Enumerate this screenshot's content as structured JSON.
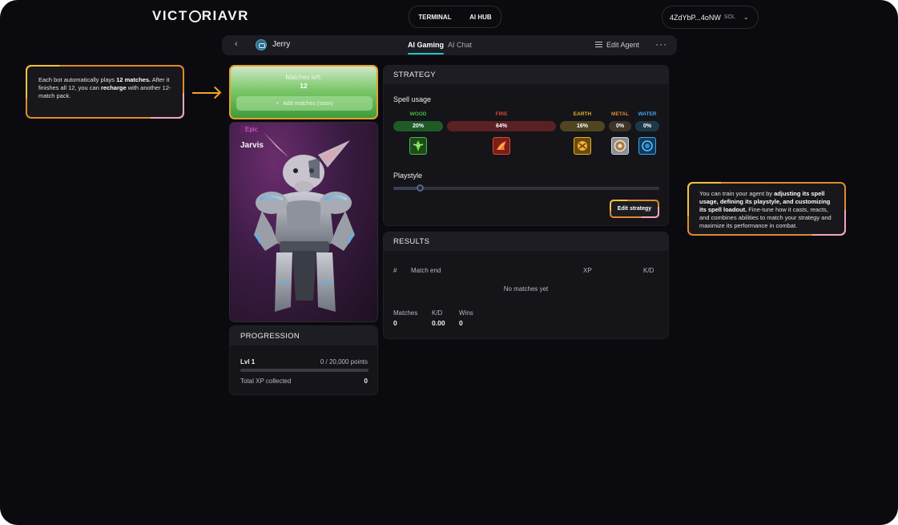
{
  "header": {
    "logo_text_1": "VICT",
    "logo_text_2": "RIAVR",
    "nav": [
      "TERMINAL",
      "AI HUB"
    ],
    "wallet_address": "4ZdYbP...4oNW",
    "wallet_currency": "SOL"
  },
  "agent_bar": {
    "agent_name": "Jerry",
    "tabs": [
      "AI Gaming",
      "AI Chat"
    ],
    "active_tab": "AI Gaming",
    "edit_label": "Edit Agent"
  },
  "callouts": {
    "left": {
      "t1": "Each bot automatically plays ",
      "b1": "12 matches.",
      "t2": " After it finishes all 12, you can ",
      "b2": "recharge",
      "t3": " with another 12-match pack."
    },
    "right": {
      "t1": "You can train your agent by ",
      "b1": "adjusting its spell usage, defining its playstyle, and customizing its spell loadout.",
      "t2": " Fine-tune how it casts, reacts, and combines abilities to match your strategy and maximize its performance in combat."
    }
  },
  "matches": {
    "label": "Matches left:",
    "count": "12",
    "add_button": "Add matches (soon)"
  },
  "character": {
    "rarity": "Epic",
    "name": "Jarvis"
  },
  "progression": {
    "title": "PROGRESSION",
    "level": "Lvl 1",
    "points": "0 / 20,000 points",
    "progress_fraction": 0,
    "xp_label": "Total XP collected",
    "xp_value": "0"
  },
  "strategy": {
    "title": "STRATEGY",
    "spell_usage_label": "Spell usage",
    "elements": [
      {
        "name": "WOOD",
        "percent": "20%",
        "color": "#3fbf3f",
        "pill": "#1f5a27",
        "icon": "wood-spell-icon"
      },
      {
        "name": "FIRE",
        "percent": "64%",
        "color": "#e0453a",
        "pill": "#5a2023",
        "icon": "fire-spell-icon"
      },
      {
        "name": "EARTH",
        "percent": "16%",
        "color": "#e6b320",
        "pill": "#4f4520",
        "icon": "earth-spell-icon"
      },
      {
        "name": "METAL",
        "percent": "0%",
        "color": "#e08a2f",
        "pill": "#3f3428",
        "icon": "metal-spell-icon"
      },
      {
        "name": "WATER",
        "percent": "0%",
        "color": "#3aa7e6",
        "pill": "#1e3a4a",
        "icon": "water-spell-icon"
      }
    ],
    "playstyle_label": "Playstyle",
    "playstyle_value": 0.1,
    "edit_button": "Edit strategy"
  },
  "results": {
    "title": "RESULTS",
    "columns": [
      "#",
      "Match end",
      "XP",
      "K/D"
    ],
    "empty_text": "No matches yet",
    "stats": [
      {
        "label": "Matches",
        "value": "0"
      },
      {
        "label": "K/D",
        "value": "0.00"
      },
      {
        "label": "Wins",
        "value": "0"
      }
    ]
  }
}
